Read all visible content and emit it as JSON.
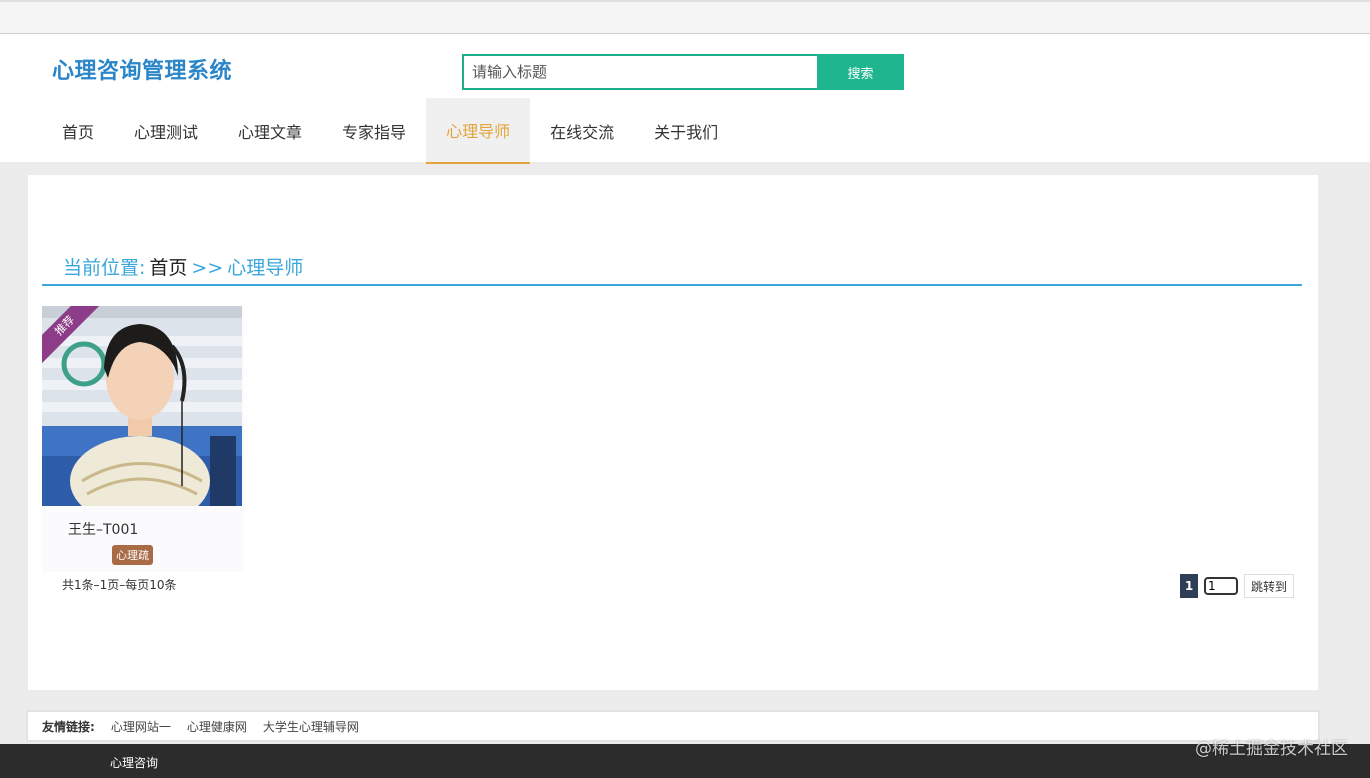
{
  "header": {
    "logo": "心理咨询管理系统",
    "search_placeholder": "请输入标题",
    "search_button": "搜索"
  },
  "nav": {
    "items": [
      "首页",
      "心理测试",
      "心理文章",
      "专家指导",
      "心理导师",
      "在线交流",
      "关于我们"
    ],
    "active_index": 4
  },
  "breadcrumb": {
    "prefix": "当前位置:",
    "home": "首页",
    "separator": ">>",
    "current": "心理导师"
  },
  "card": {
    "ribbon": "推荐",
    "name": "王生–T001",
    "tag": "心理疏"
  },
  "pagination": {
    "summary": "共1条–1页–每页10条",
    "current_page": "1",
    "input_value": "1",
    "jump_label": "跳转到"
  },
  "links": {
    "label": "友情链接:",
    "items": [
      "心理网站一",
      "心理健康网",
      "大学生心理辅导网"
    ]
  },
  "footer": {
    "text": "心理咨询",
    "watermark": "@稀土掘金技术社区"
  },
  "colors": {
    "accent_blue": "#3aa6dc",
    "search_green": "#1eb58f",
    "nav_active": "#e3a43b",
    "ribbon_purple": "#8d3d87",
    "tag_brown": "#a86b45"
  }
}
